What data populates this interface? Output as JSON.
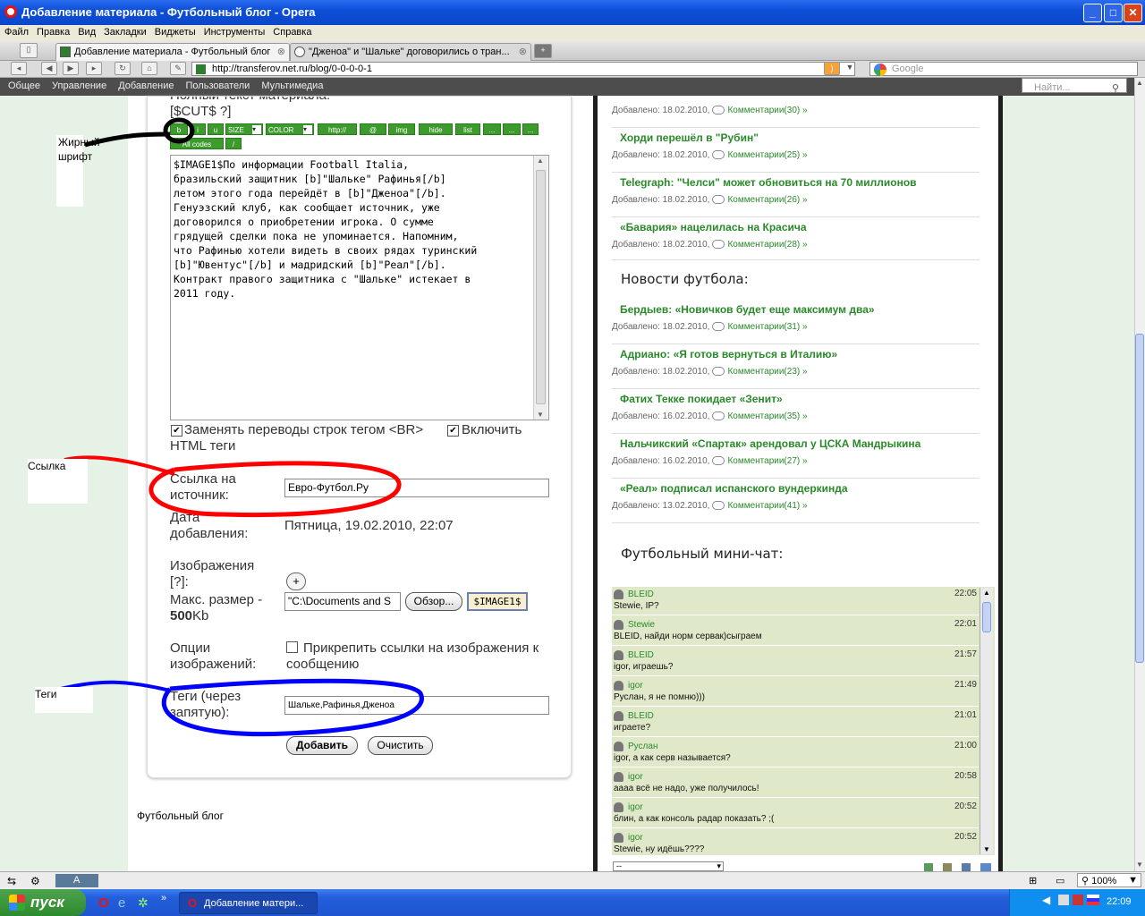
{
  "window": {
    "title": "Добавление материала - Футбольный блог - Opera",
    "controls": [
      "_",
      "□",
      "✕"
    ]
  },
  "menu": [
    "Файл",
    "Правка",
    "Вид",
    "Закладки",
    "Виджеты",
    "Инструменты",
    "Справка"
  ],
  "tabs": [
    {
      "label": "Добавление материала - Футбольный блог"
    },
    {
      "label": "\"Дженоа\" и \"Шальке\" договорились о тран..."
    }
  ],
  "address": {
    "url": "http://transferov.net.ru/blog/0-0-0-0-1",
    "search_placeholder": "Google"
  },
  "site_nav": {
    "items": [
      "Общее",
      "Управление",
      "Добавление",
      "Пользователи",
      "Мультимедиа"
    ],
    "search_placeholder": "Найти..."
  },
  "form": {
    "fulltext_label": "Полный текст материала: [$CUT$ ?]",
    "bb_buttons": [
      "b",
      "i",
      "u",
      "SIZE",
      "COLOR",
      "http://",
      "@",
      "img",
      "hide",
      "list",
      "...",
      "...",
      "..."
    ],
    "bb_buttons2": [
      "All codes",
      "/"
    ],
    "editor_text": "$IMAGE1$По информации Football Italia,\nбразильский защитник [b]\"Шальке\" Рафинья[/b]\nлетом этого года перейдёт в [b]\"Дженоа\"[/b].\nГенуэзский клуб, как сообщает источник, уже\nдоговорился о приобретении игрока. О сумме\nгрядущей сделки пока не упоминается. Напомним,\nчто Рафинью хотели видеть в своих рядах туринский\n[b]\"Ювентус\"[/b] и мадридский [b]\"Реал\"[/b].\nКонтракт правого защитника с \"Шальке\" истекает в\n2011 году.",
    "br_option": "Заменять переводы строк тегом <BR>",
    "html_option": "Включить HTML теги",
    "source_label": "Ссылка на источник:",
    "source_value": "Евро-Футбол.Ру",
    "date_label": "Дата добавления:",
    "date_value": "Пятница, 19.02.2010, 22:07",
    "images_label": "Изображения [?]:",
    "maxsize_label": "Макс. размер -",
    "maxsize_value": "500",
    "maxsize_unit": "Kb",
    "file_value": "\"C:\\Documents and S",
    "browse_label": "Обзор...",
    "image_tag": "$IMAGE1$",
    "img_options_label": "Опции изображений:",
    "img_options_value": "Прикрепить ссылки на изображения к сообщению",
    "tags_label": "Теги (через запятую):",
    "tags_value": "Шальке,Рафинья,Дженоа",
    "submit_label": "Добавить",
    "reset_label": "Очистить"
  },
  "footer": "Футбольный блог",
  "right": {
    "top_meta": "Добавлено: 18.02.2010,",
    "top_comments": "Комментарии(30) »",
    "news1": [
      {
        "title": "Хорди перешёл в \"Рубин\"",
        "date": "Добавлено: 18.02.2010,",
        "comments": "Комментарии(25) »"
      },
      {
        "title": "Telegraph: \"Челси\" может обновиться на 70 миллионов",
        "date": "Добавлено: 18.02.2010,",
        "comments": "Комментарии(26) »"
      },
      {
        "title": "«Бавария» нацелилась на Красича",
        "date": "Добавлено: 18.02.2010,",
        "comments": "Комментарии(28) »"
      }
    ],
    "news_heading": "Новости футбола:",
    "news2": [
      {
        "title": "Бердыев: «Новичков будет еще максимум два»",
        "date": "Добавлено: 18.02.2010,",
        "comments": "Комментарии(31) »"
      },
      {
        "title": "Адриано: «Я готов вернуться в Италию»",
        "date": "Добавлено: 18.02.2010,",
        "comments": "Комментарии(23) »"
      },
      {
        "title": "Фатих Текке покидает «Зенит»",
        "date": "Добавлено: 16.02.2010,",
        "comments": "Комментарии(35) »"
      },
      {
        "title": "Нальчикский «Спартак» арендовал у ЦСКА Мандрыкина",
        "date": "Добавлено: 16.02.2010,",
        "comments": "Комментарии(27) »"
      },
      {
        "title": "«Реал» подписал испанского вундеркинда",
        "date": "Добавлено: 13.02.2010,",
        "comments": "Комментарии(41) »"
      }
    ],
    "chat_heading": "Футбольный мини-чат:",
    "chat": [
      {
        "name": "BLEID",
        "time": "22:05",
        "msg": "Stewie, IP?"
      },
      {
        "name": "Stewie",
        "time": "22:01",
        "msg": "BLEID, найди норм сервак)сыграем"
      },
      {
        "name": "BLEID",
        "time": "21:57",
        "msg": "igor, играешь?"
      },
      {
        "name": "igor",
        "time": "21:49",
        "msg": "Руслан, я не помню)))"
      },
      {
        "name": "BLEID",
        "time": "21:01",
        "msg": "играете?"
      },
      {
        "name": "Руслан",
        "time": "21:00",
        "msg": "igor, а как серв называется?"
      },
      {
        "name": "igor",
        "time": "20:58",
        "msg": "аааа всё не надо, уже получилось!"
      },
      {
        "name": "igor",
        "time": "20:52",
        "msg": "блин, а как консоль радар показать? ;("
      },
      {
        "name": "igor",
        "time": "20:52",
        "msg": "Stewie, ну идёшь????"
      }
    ],
    "chat_select": "--"
  },
  "annotations": {
    "bold": "Жирный шрифт",
    "link": "Ссылка",
    "tags": "Теги",
    "colors": {
      "bold": "#000000",
      "link": "#ff0000",
      "tags": "#0000ff"
    }
  },
  "status": {
    "zoom": "100%",
    "panel": "A"
  },
  "taskbar": {
    "start": "пуск",
    "item": "Добавление матери...",
    "lang": "RU",
    "clock": "22:09"
  }
}
